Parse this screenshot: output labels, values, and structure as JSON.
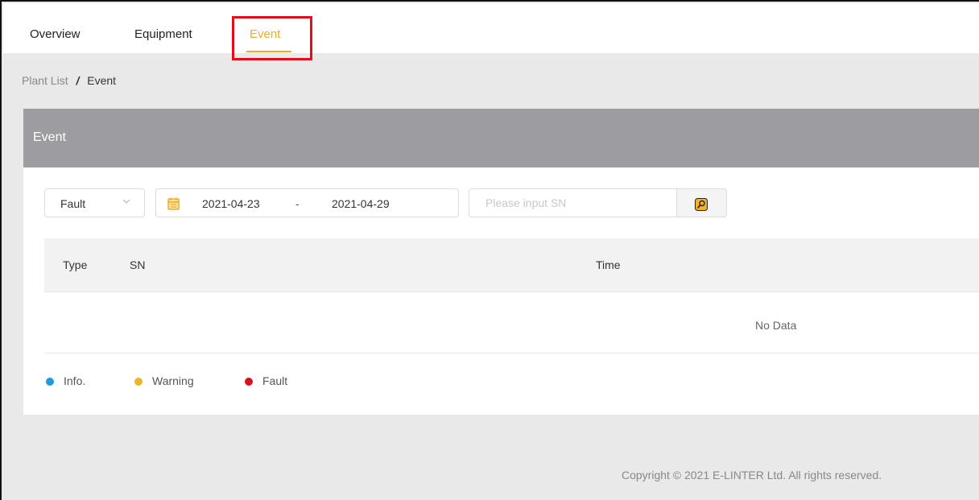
{
  "tabs": [
    {
      "label": "Overview",
      "active": false
    },
    {
      "label": "Equipment",
      "active": false
    },
    {
      "label": "Event",
      "active": true
    }
  ],
  "breadcrumb": {
    "parent": "Plant List",
    "separator": "/",
    "current": "Event"
  },
  "panel": {
    "title": "Event"
  },
  "filters": {
    "type_select": {
      "value": "Fault"
    },
    "date_range": {
      "start": "2021-04-23",
      "separator": "-",
      "end": "2021-04-29"
    },
    "sn_input": {
      "value": "",
      "placeholder": "Please input SN"
    }
  },
  "table": {
    "columns": [
      "Type",
      "SN",
      "Time"
    ],
    "rows": [],
    "empty_text": "No Data"
  },
  "legend": [
    {
      "label": "Info.",
      "color": "#1e9be0"
    },
    {
      "label": "Warning",
      "color": "#f0b22a"
    },
    {
      "label": "Fault",
      "color": "#d6121c"
    }
  ],
  "footer": {
    "copyright": "Copyright © 2021 E-LINTER Ltd. All rights reserved."
  },
  "colors": {
    "accent": "#f0a92a",
    "highlight": "#e10f1b",
    "header_bg": "#9c9ca1"
  }
}
